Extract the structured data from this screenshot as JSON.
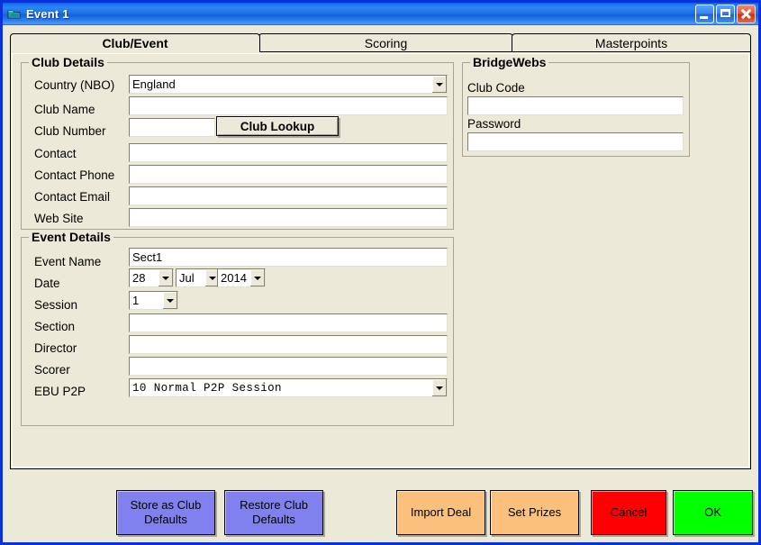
{
  "window": {
    "title": "Event 1",
    "icon": "app-folder-icon",
    "controls": {
      "minimize": "Minimize",
      "maximize": "Maximize",
      "close": "Close"
    },
    "accent_border": "#0831d9",
    "face_color": "#ece9d8"
  },
  "tabs": [
    {
      "label": "Club/Event",
      "active": true
    },
    {
      "label": "Scoring",
      "active": false
    },
    {
      "label": "Masterpoints",
      "active": false
    }
  ],
  "club_details": {
    "legend": "Club Details",
    "country_label": "Country (NBO)",
    "country_value": "England",
    "club_name_label": "Club Name",
    "club_name_value": "",
    "club_number_label": "Club Number",
    "club_number_value": "",
    "club_lookup_button": "Club Lookup",
    "contact_label": "Contact",
    "contact_value": "",
    "contact_phone_label": "Contact Phone",
    "contact_phone_value": "",
    "contact_email_label": "Contact Email",
    "contact_email_value": "",
    "web_site_label": "Web Site",
    "web_site_value": ""
  },
  "bridgewebs": {
    "legend": "BridgeWebs",
    "club_code_label": "Club Code",
    "club_code_value": "",
    "password_label": "Password",
    "password_value": ""
  },
  "event_details": {
    "legend": "Event Details",
    "event_name_label": "Event Name",
    "event_name_value": "Sect1",
    "date_label": "Date",
    "date_day": "28",
    "date_month": "Jul",
    "date_year": "2014",
    "session_label": "Session",
    "session_value": "1",
    "section_label": "Section",
    "section_value": "",
    "director_label": "Director",
    "director_value": "",
    "scorer_label": "Scorer",
    "scorer_value": "",
    "ebu_p2p_label": "EBU P2P",
    "ebu_p2p_value": "10 Normal P2P Session"
  },
  "footer_buttons": [
    {
      "name": "store-as-club-defaults",
      "line1": "Store as Club",
      "line2": "Defaults",
      "color": "#8080ee"
    },
    {
      "name": "restore-club-defaults",
      "line1": "Restore Club",
      "line2": "Defaults",
      "color": "#8080ee"
    },
    {
      "name": "import-deal",
      "line1": "Import Deal",
      "line2": "",
      "color": "#fbc07c"
    },
    {
      "name": "set-prizes",
      "line1": "Set Prizes",
      "line2": "",
      "color": "#fbc07c"
    },
    {
      "name": "cancel",
      "line1": "Cancel",
      "line2": "",
      "color": "#ff0000"
    },
    {
      "name": "ok",
      "line1": "OK",
      "line2": "",
      "color": "#00ff00"
    }
  ]
}
